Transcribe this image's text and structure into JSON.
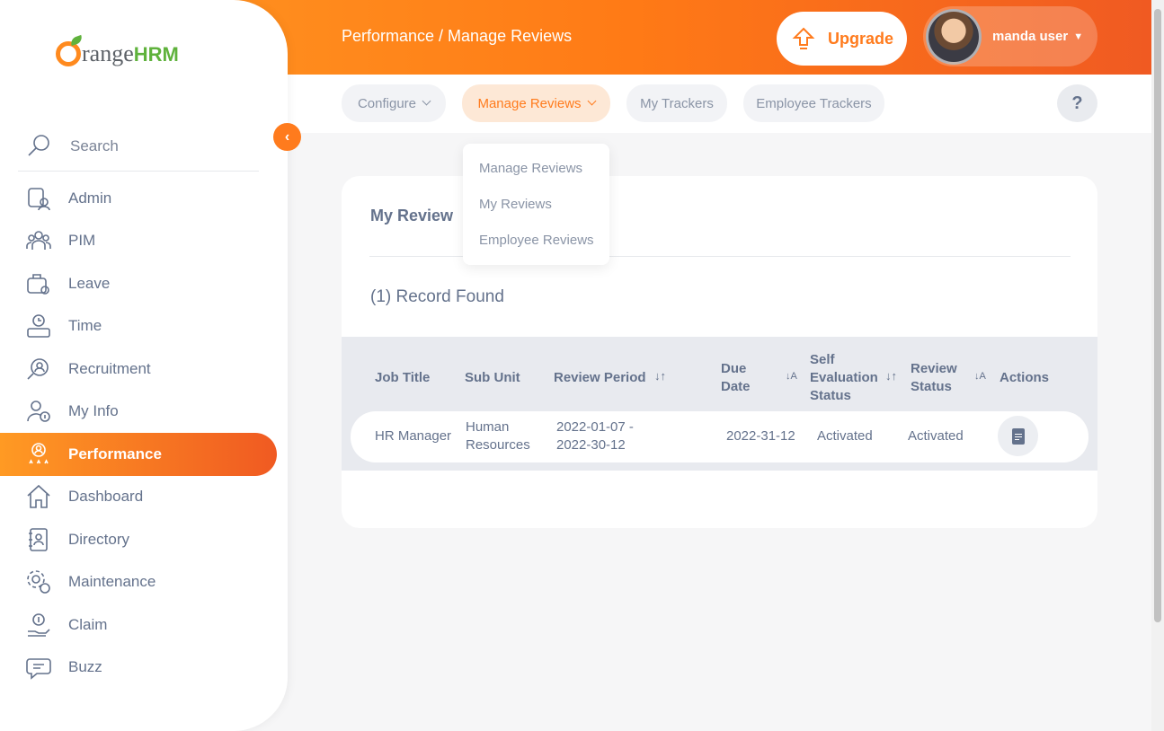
{
  "header": {
    "breadcrumb": "Performance / Manage Reviews",
    "upgrade_label": "Upgrade",
    "user_name": "manda user"
  },
  "subnav": {
    "items": [
      {
        "label": "Configure"
      },
      {
        "label": "Manage Reviews"
      },
      {
        "label": "My Trackers"
      },
      {
        "label": "Employee Trackers"
      }
    ],
    "help": "?"
  },
  "dropdown": {
    "items": [
      "Manage Reviews",
      "My Reviews",
      "Employee Reviews"
    ]
  },
  "sidebar": {
    "logo": {
      "brand": "range",
      "suffix": "HRM"
    },
    "search_label": "Search",
    "items": [
      {
        "label": "Admin"
      },
      {
        "label": "PIM"
      },
      {
        "label": "Leave"
      },
      {
        "label": "Time"
      },
      {
        "label": "Recruitment"
      },
      {
        "label": "My Info"
      },
      {
        "label": "Performance"
      },
      {
        "label": "Dashboard"
      },
      {
        "label": "Directory"
      },
      {
        "label": "Maintenance"
      },
      {
        "label": "Claim"
      },
      {
        "label": "Buzz"
      }
    ]
  },
  "main": {
    "card_title": "My Review",
    "record_found": "(1) Record Found",
    "columns": {
      "job_title": "Job Title",
      "sub_unit": "Sub Unit",
      "review_period": "Review Period",
      "due_date": [
        "Due",
        "Date"
      ],
      "self_eval": [
        "Self",
        "Evaluation",
        "Status"
      ],
      "review_status": [
        "Review",
        "Status"
      ],
      "actions": "Actions"
    },
    "rows": [
      {
        "job_title": "HR Manager",
        "sub_unit": [
          "Human",
          "Resources"
        ],
        "review_period": [
          "2022-01-07 -",
          "2022-30-12"
        ],
        "due_date": "2022-31-12",
        "self_eval": "Activated",
        "review_status": "Activated"
      }
    ]
  },
  "colors": {
    "accent": "#ff7b1d",
    "accent_dark": "#f05a22",
    "text": "#64728c",
    "leaf": "#5fb23c"
  }
}
